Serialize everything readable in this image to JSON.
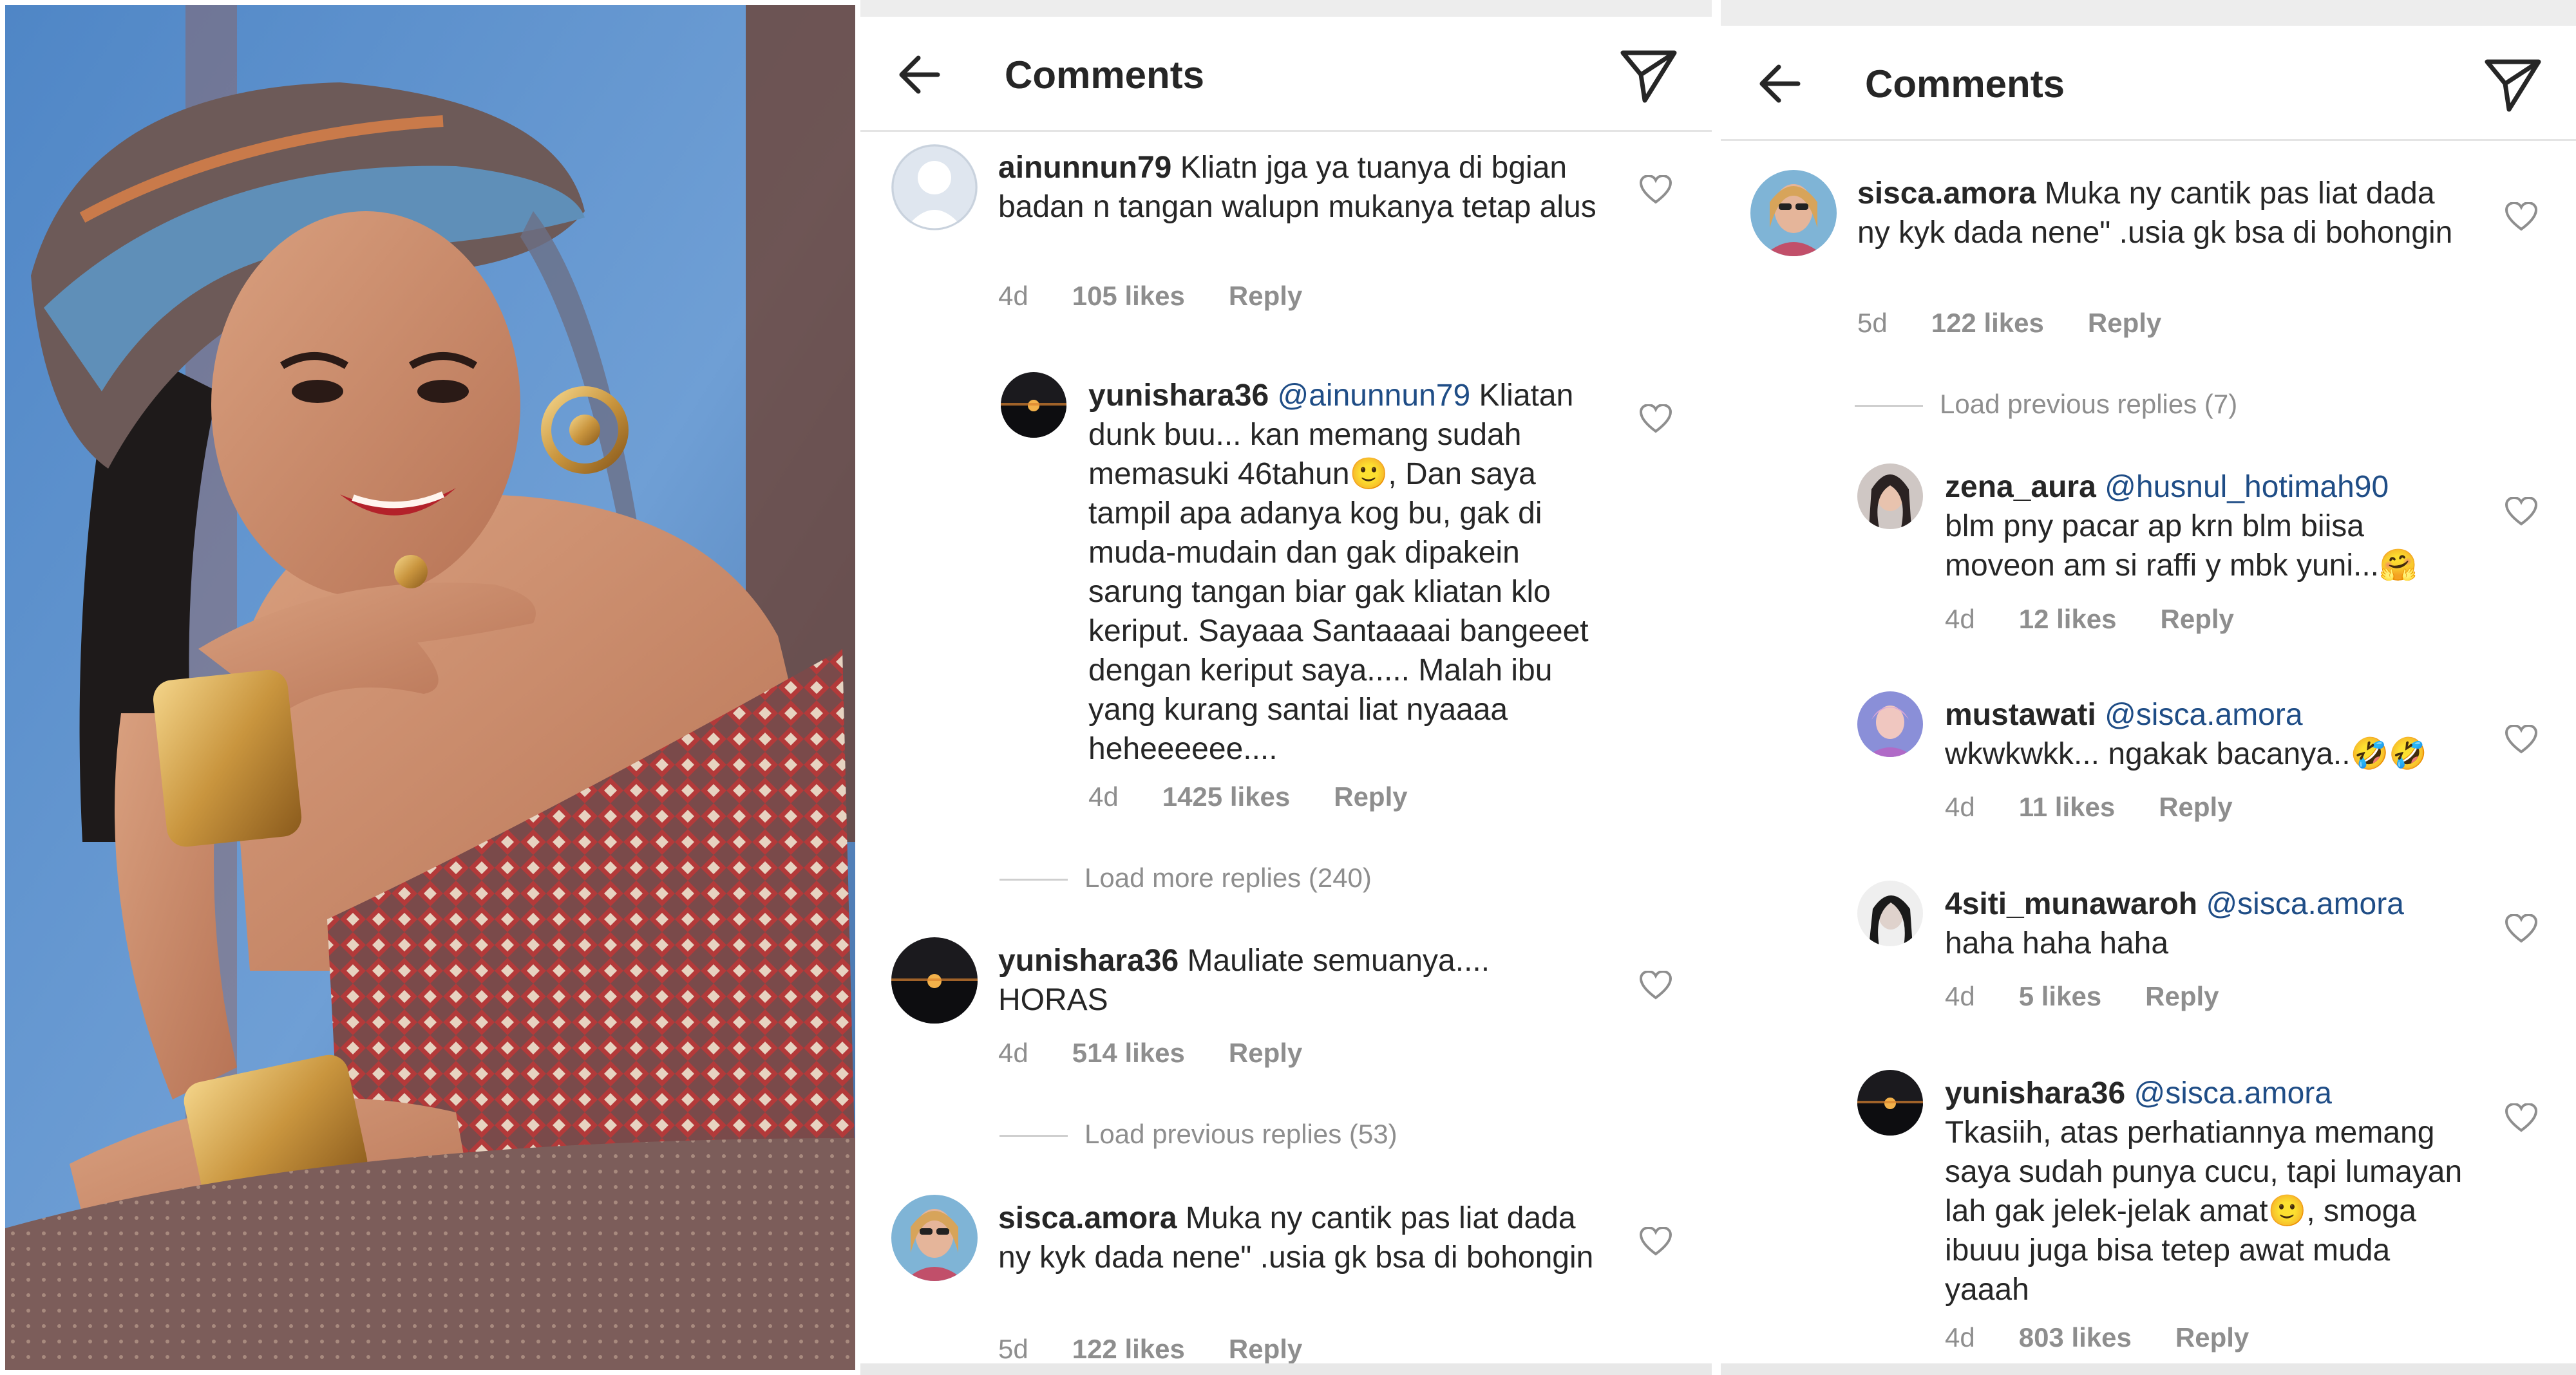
{
  "colors": {
    "username": "#262626",
    "text": "#262626",
    "meta": "#8e8e8e",
    "mention": "#1f4d86",
    "header_bg": "#ffffff"
  },
  "photo": {
    "description_icon": "portrait-photo"
  },
  "panel1": {
    "header": {
      "title": "Comments",
      "back_icon": "arrow-left-icon",
      "send_icon": "paper-plane-icon"
    },
    "comments": [
      {
        "user": "ainunnun79",
        "text": "Kliatn jga ya tuanya di bgian badan n tangan walupn mukanya tetap alus",
        "age": "4d",
        "likes": "105 likes",
        "reply": "Reply"
      },
      {
        "user": "yunishara36",
        "mention": "@ainunnun79",
        "text": " Kliatan dunk buu... kan memang sudah memasuki 46tahun🙂, Dan saya tampil apa adanya kog bu, gak di muda-mudain dan gak dipakein sarung tangan biar gak kliatan klo keriput.  Sayaaa Santaaaai bangeeet dengan keriput saya..... Malah ibu yang kurang santai liat nyaaaa heheeeeee....",
        "age": "4d",
        "likes": "1425 likes",
        "reply": "Reply"
      },
      {
        "user": "yunishara36",
        "text": "Mauliate semuanya.... HORAS",
        "age": "4d",
        "likes": "514 likes",
        "reply": "Reply"
      },
      {
        "user": "sisca.amora",
        "text": "Muka ny cantik pas liat dada ny kyk dada nene\" .usia gk bsa di bohongin",
        "age": "5d",
        "likes": "122 likes",
        "reply": "Reply"
      }
    ],
    "load_more": "Load more replies (240)",
    "load_previous": "Load previous replies (53)"
  },
  "panel2": {
    "header": {
      "title": "Comments",
      "back_icon": "arrow-left-icon",
      "send_icon": "paper-plane-icon"
    },
    "comments": [
      {
        "user": "sisca.amora",
        "text": "Muka ny cantik pas liat dada ny kyk dada nene\" .usia gk bsa di bohongin",
        "age": "5d",
        "likes": "122 likes",
        "reply": "Reply"
      },
      {
        "user": "zena_aura",
        "mention": "@husnul_hotimah90",
        "text": "blm pny pacar ap krn blm biisa moveon am si raffi y mbk yuni...🤗",
        "age": "4d",
        "likes": "12 likes",
        "reply": "Reply"
      },
      {
        "user": "mustawati",
        "mention": "@sisca.amora",
        "text": "wkwkwkk... ngakak bacanya..🤣🤣",
        "age": "4d",
        "likes": "11 likes",
        "reply": "Reply"
      },
      {
        "user": "4siti_munawaroh",
        "mention": "@sisca.amora",
        "text": "haha haha haha",
        "age": "4d",
        "likes": "5 likes",
        "reply": "Reply"
      },
      {
        "user": "yunishara36",
        "mention": "@sisca.amora",
        "text": "Tkasiih, atas perhatiannya memang saya sudah punya cucu, tapi lumayan lah gak jelek-jelak amat🙂, smoga ibuuu juga bisa tetep awat muda yaaah",
        "age": "4d",
        "likes": "803 likes",
        "reply": "Reply"
      }
    ],
    "load_previous": "Load previous replies (7)"
  }
}
